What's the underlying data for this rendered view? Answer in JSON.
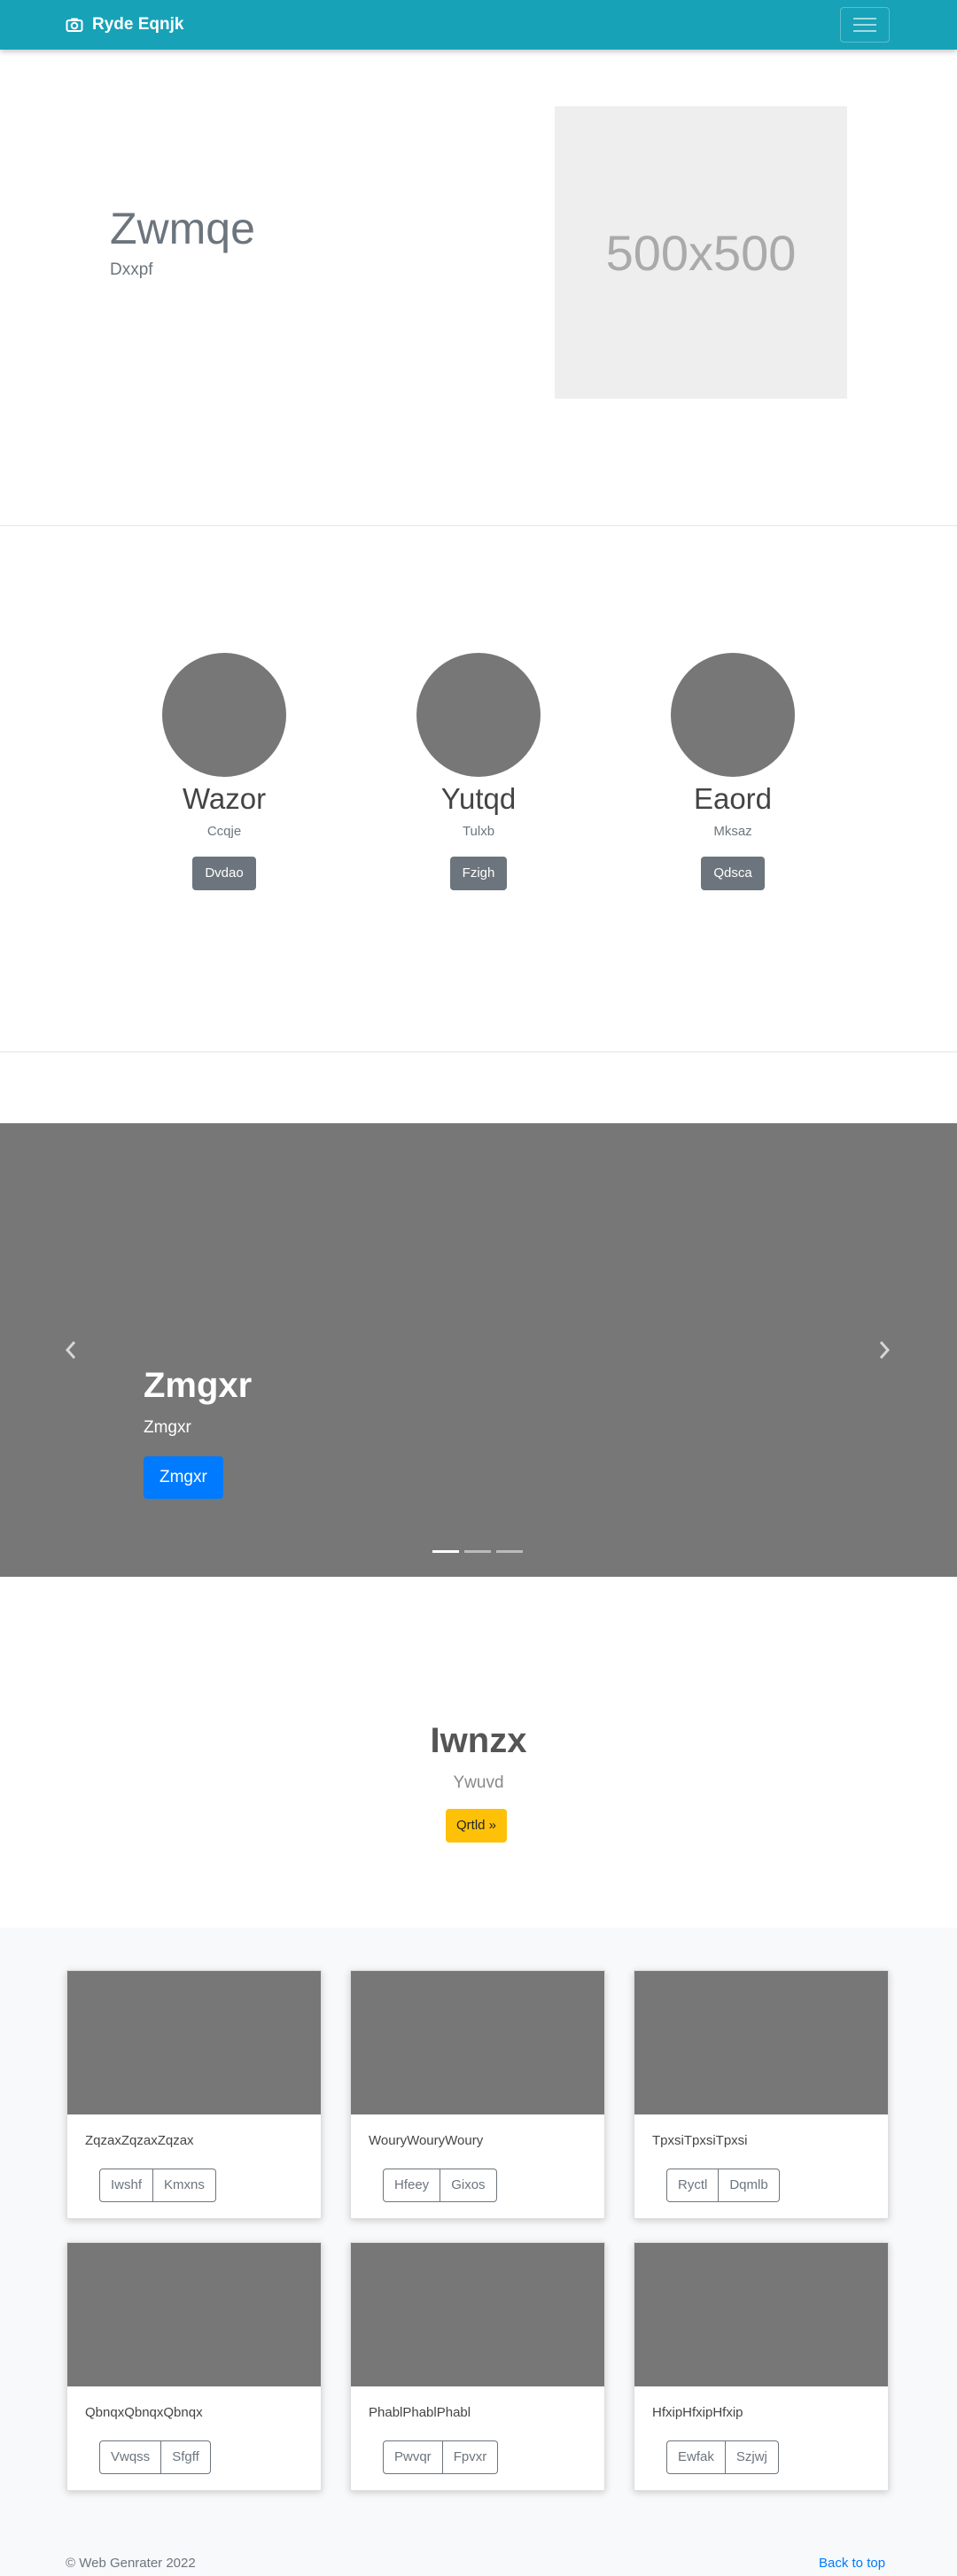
{
  "navbar": {
    "brand": "Ryde Eqnjk",
    "brand_icon": "camera-icon",
    "toggler_icon": "hamburger-icon",
    "background": "#17a2b8"
  },
  "hero": {
    "title": "Zwmqe",
    "subtitle": "Dxxpf",
    "image_placeholder": "500x500"
  },
  "people": [
    {
      "name": "Wazor",
      "role": "Ccqje",
      "button": "Dvdao"
    },
    {
      "name": "Yutqd",
      "role": "Tulxb",
      "button": "Fzigh"
    },
    {
      "name": "Eaord",
      "role": "Mksaz",
      "button": "Qdsca"
    }
  ],
  "carousel": {
    "title": "Zmgxr",
    "subtitle": "Zmgxr",
    "button": "Zmgxr",
    "prev_icon": "chevron-left-icon",
    "next_icon": "chevron-right-icon",
    "slide_count": 3,
    "active_slide": 1
  },
  "cta": {
    "title": "Iwnzx",
    "subtitle": "Ywuvd",
    "button": "Qrtld »"
  },
  "album": [
    {
      "text": "ZqzaxZqzaxZqzax",
      "buttons": [
        "Iwshf",
        "Kmxns"
      ]
    },
    {
      "text": "WouryWouryWoury",
      "buttons": [
        "Hfeey",
        "Gixos"
      ]
    },
    {
      "text": "TpxsiTpxsiTpxsi",
      "buttons": [
        "Ryctl",
        "Dqmlb"
      ]
    },
    {
      "text": "QbnqxQbnqxQbnqx",
      "buttons": [
        "Vwqss",
        "Sfgff"
      ]
    },
    {
      "text": "PhablPhablPhabl",
      "buttons": [
        "Pwvqr",
        "Fpvxr"
      ]
    },
    {
      "text": "HfxipHfxipHfxip",
      "buttons": [
        "Ewfak",
        "Szjwj"
      ]
    }
  ],
  "footer": {
    "copyright": "© Web Genrater 2022",
    "back_to_top": "Back to top"
  }
}
